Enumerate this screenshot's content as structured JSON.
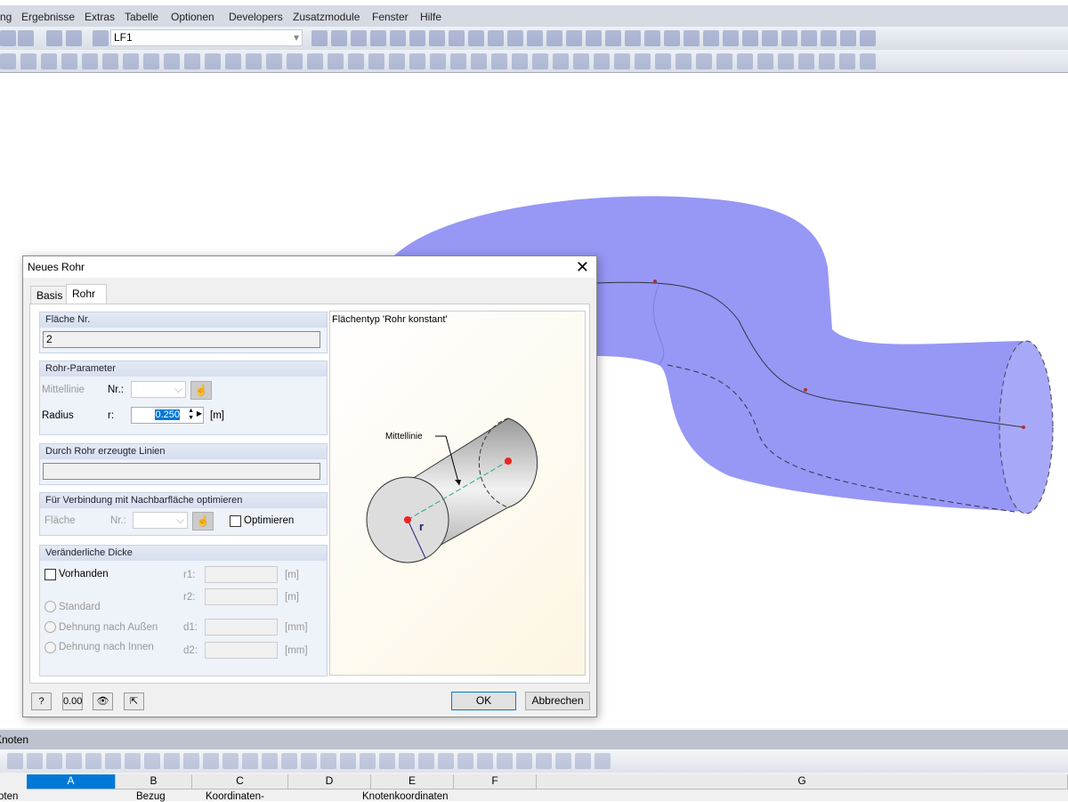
{
  "menu": [
    "ng",
    "Ergebnisse",
    "Extras",
    "Tabelle",
    "Optionen",
    "Developers",
    "Zusatzmodule",
    "Fenster",
    "Hilfe"
  ],
  "toolbar": {
    "load_case": "LF1"
  },
  "dialog": {
    "title": "Neues Rohr",
    "tabs": [
      "Basis",
      "Rohr"
    ],
    "active_tab": "Rohr",
    "flaeche": {
      "header": "Fläche Nr.",
      "value": "2"
    },
    "rohr_parameter": {
      "header": "Rohr-Parameter",
      "mittellinie_label": "Mittellinie",
      "nr_label": "Nr.:",
      "nr_value": "",
      "radius_label": "Radius",
      "r_label": "r:",
      "r_value": "0.250",
      "r_unit": "[m]"
    },
    "linien": {
      "header": "Durch Rohr erzeugte Linien",
      "value": ""
    },
    "verbindung": {
      "header": "Für Verbindung mit Nachbarfläche optimieren",
      "flaeche_label": "Fläche",
      "nr_label": "Nr.:",
      "optimieren_label": "Optimieren",
      "optimieren_checked": false
    },
    "dicke": {
      "header": "Veränderliche Dicke",
      "vorhanden_label": "Vorhanden",
      "vorhanden_checked": false,
      "options": [
        "Standard",
        "Dehnung nach Außen",
        "Dehnung nach Innen"
      ],
      "r1_label": "r1:",
      "r2_label": "r2:",
      "d1_label": "d1:",
      "d2_label": "d2:",
      "unit_m": "[m]",
      "unit_mm": "[mm]"
    },
    "preview": {
      "caption": "Flächentyp 'Rohr konstant'",
      "mittellinie": "Mittellinie",
      "r": "r"
    },
    "ok": "OK",
    "cancel": "Abbrechen"
  },
  "bottom": {
    "title": "Knoten",
    "columns": [
      "A",
      "B",
      "C",
      "D",
      "E",
      "F",
      "G"
    ],
    "row_labels": [
      "oten",
      "Bezug",
      "Koordinaten-",
      "Knotenkoordinaten"
    ]
  },
  "colors": {
    "pipe": "#8080f0",
    "selected_col": "#0078d7"
  }
}
